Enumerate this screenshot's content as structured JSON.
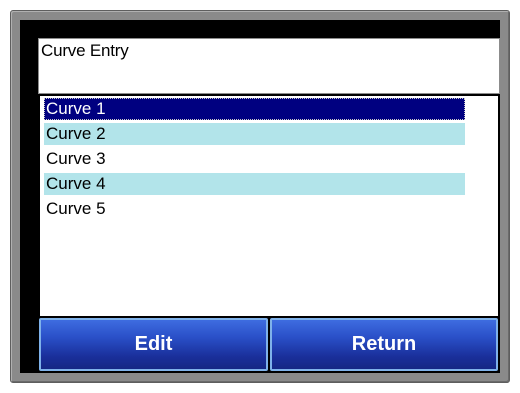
{
  "header": {
    "title": "Curve Entry"
  },
  "curves": {
    "items": [
      {
        "label": "Curve 1"
      },
      {
        "label": "Curve 2"
      },
      {
        "label": "Curve 3"
      },
      {
        "label": "Curve 4"
      },
      {
        "label": "Curve 5"
      }
    ],
    "selected_label": "Curve 1"
  },
  "buttons": {
    "edit_label": "Edit",
    "return_label": "Return"
  },
  "colors": {
    "selected_row": "#000080",
    "alt_row": "#b2e4ea",
    "button_blue": "#2a50c8",
    "bezel": "#8a8a8a"
  }
}
